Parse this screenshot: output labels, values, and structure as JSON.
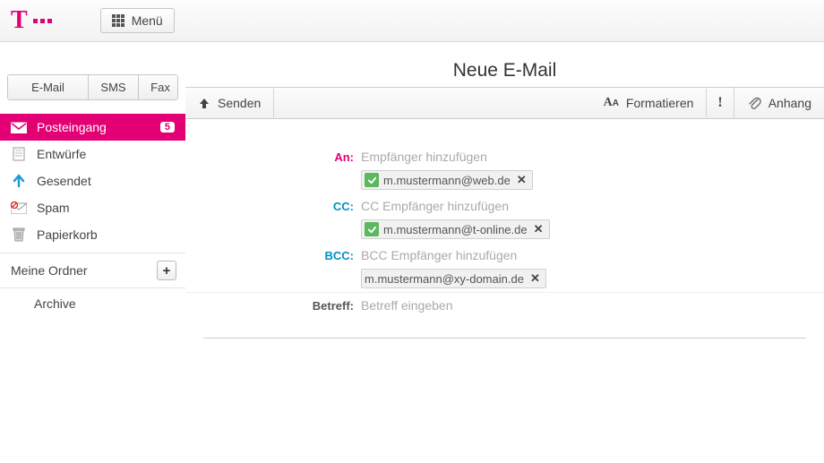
{
  "header": {
    "menu_label": "Menü"
  },
  "sidebar": {
    "tabs": {
      "email": "E-Mail",
      "sms": "SMS",
      "fax": "Fax"
    },
    "folders": [
      {
        "label": "Posteingang",
        "badge": "5",
        "active": true
      },
      {
        "label": "Entwürfe"
      },
      {
        "label": "Gesendet"
      },
      {
        "label": "Spam"
      },
      {
        "label": "Papierkorb"
      }
    ],
    "section_label": "Meine Ordner",
    "subfolders": [
      {
        "label": "Archive"
      }
    ]
  },
  "content": {
    "title": "Neue E-Mail",
    "toolbar": {
      "send": "Senden",
      "format": "Formatieren",
      "attach": "Anhang"
    },
    "compose": {
      "to_label": "An:",
      "to_placeholder": "Empfänger hinzufügen",
      "to_chip": "m.mustermann@web.de",
      "cc_label": "CC:",
      "cc_placeholder": "CC Empfänger hinzufügen",
      "cc_chip": "m.mustermann@t-online.de",
      "bcc_label": "BCC:",
      "bcc_placeholder": "BCC Empfänger hinzufügen",
      "bcc_chip": "m.mustermann@xy-domain.de",
      "subject_label": "Betreff:",
      "subject_placeholder": "Betreff eingeben"
    }
  },
  "colors": {
    "brand": "#e20074",
    "accent_blue": "#0090c4",
    "success": "#5cb85c"
  }
}
